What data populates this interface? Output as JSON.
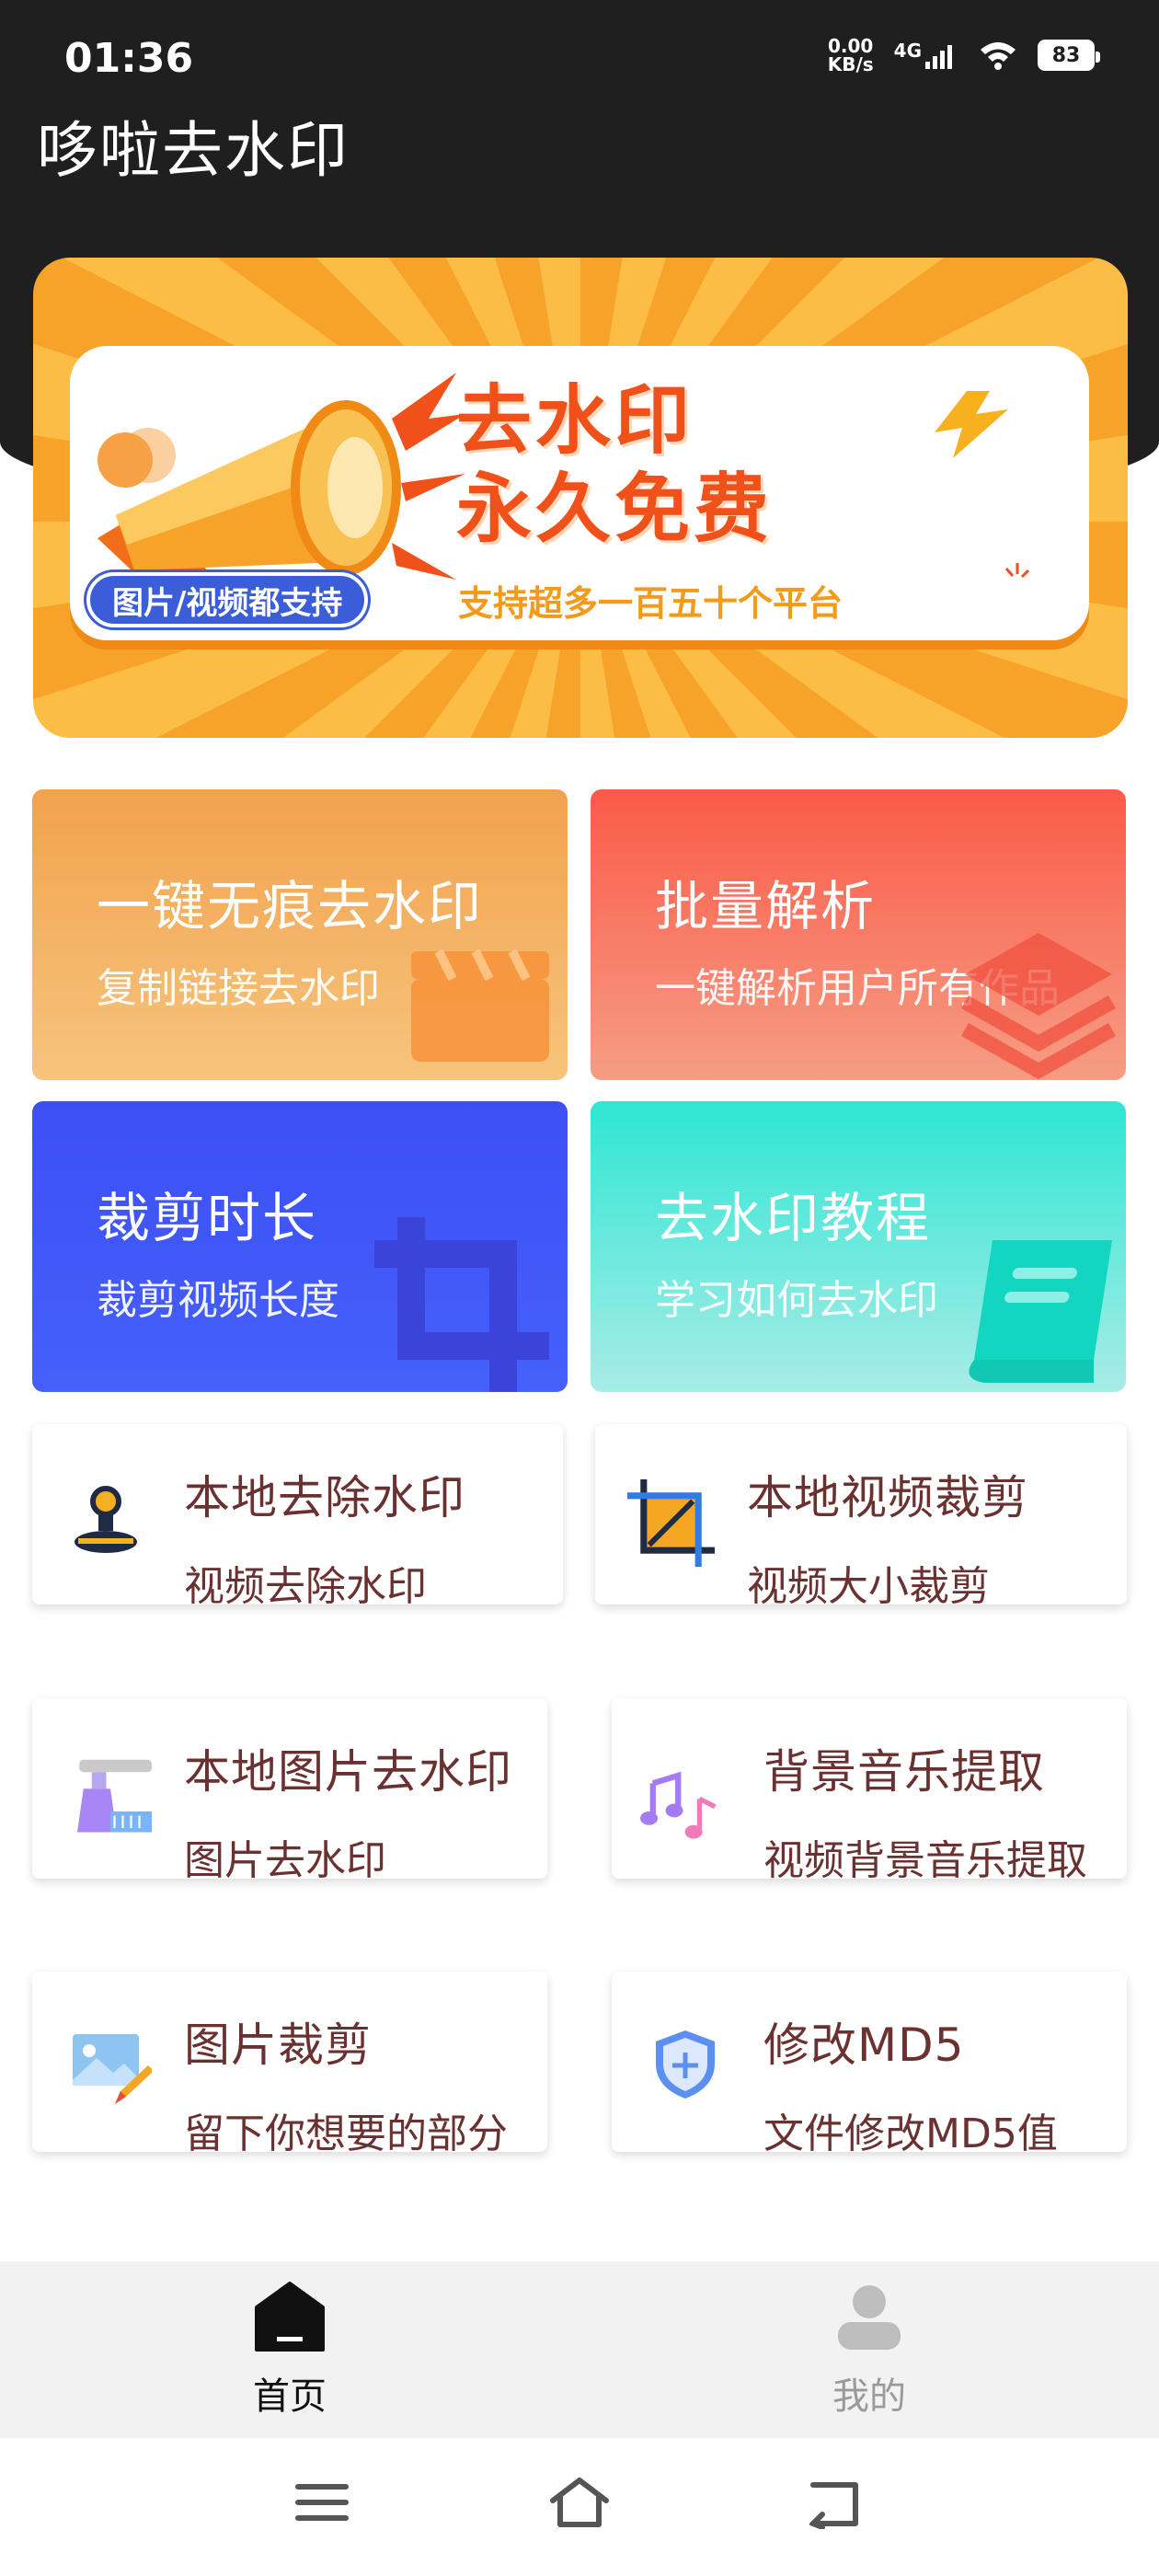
{
  "status_bar": {
    "time": "01:36",
    "net_speed_value": "0.00",
    "net_speed_unit": "KB/s",
    "network": "4G",
    "battery": "83"
  },
  "app": {
    "title": "哆啦去水印"
  },
  "banner": {
    "title_line1": "去水印",
    "title_line2": "永久免费",
    "pill": "图片/视频都支持",
    "subtitle": "支持超多一百五十个平台"
  },
  "features": [
    {
      "title": "一键无痕去水印",
      "subtitle": "复制链接去水印",
      "icon": "clapperboard-icon"
    },
    {
      "title": "批量解析",
      "subtitle": "一键解析用户所有作品",
      "icon": "layers-icon"
    },
    {
      "title": "裁剪时长",
      "subtitle": "裁剪视频长度",
      "icon": "crop-icon"
    },
    {
      "title": "去水印教程",
      "subtitle": "学习如何去水印",
      "icon": "book-icon"
    }
  ],
  "tools": [
    {
      "title": "本地去除水印",
      "subtitle": "视频去除水印",
      "icon": "stamp-icon"
    },
    {
      "title": "本地视频裁剪",
      "subtitle": "视频大小裁剪",
      "icon": "crop-frame-icon"
    },
    {
      "title": "本地图片去水印",
      "subtitle": "图片去水印",
      "icon": "cleaner-icon"
    },
    {
      "title": "背景音乐提取",
      "subtitle": "视频背景音乐提取",
      "icon": "music-note-icon"
    },
    {
      "title": "图片裁剪",
      "subtitle": "留下你想要的部分",
      "icon": "image-edit-icon"
    },
    {
      "title": "修改MD5",
      "subtitle": "文件修改MD5值",
      "icon": "shield-plus-icon"
    }
  ],
  "bottom_nav": {
    "home_label": "首页",
    "mine_label": "我的"
  },
  "colors": {
    "header_bg": "#1f1f1f",
    "tool_text": "#6a3130",
    "banner_orange": "#f7a32a"
  }
}
